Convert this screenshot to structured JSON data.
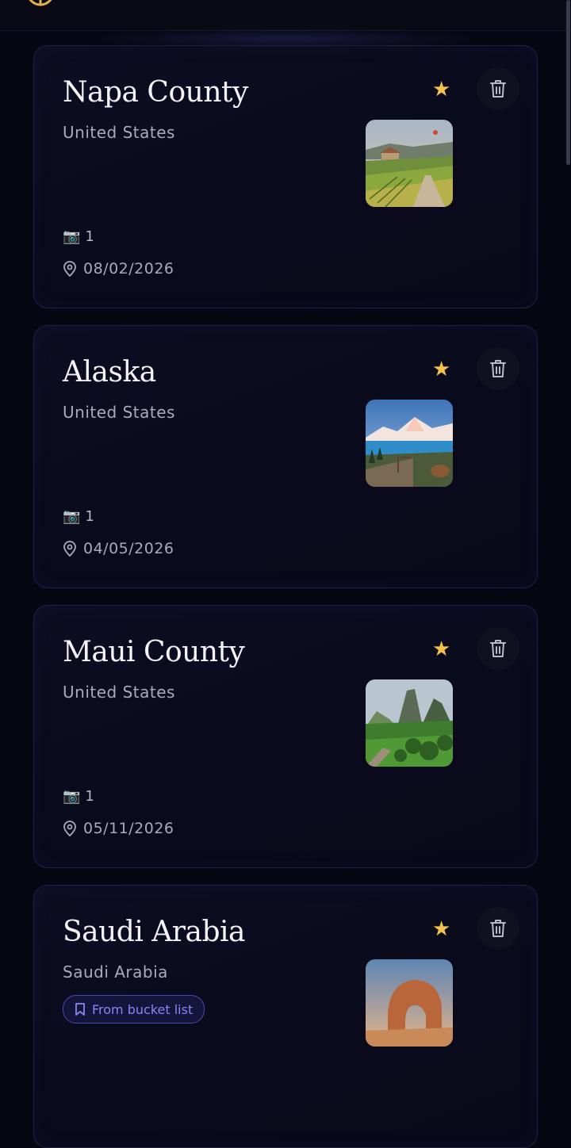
{
  "colors": {
    "background": "#070714",
    "card_border": "#1f2140",
    "star": "#f2c14e",
    "badge_accent": "#8b85f5",
    "logo": "#e0b24a"
  },
  "header": {
    "logo_icon": "globe-logo-icon"
  },
  "trips": [
    {
      "title": "Napa County",
      "country": "United States",
      "favorite": true,
      "photo_count": "1",
      "date": "08/02/2026",
      "thumbnail": "vineyard-photo"
    },
    {
      "title": "Alaska",
      "country": "United States",
      "favorite": true,
      "photo_count": "1",
      "date": "04/05/2026",
      "thumbnail": "mountain-lake-photo"
    },
    {
      "title": "Maui County",
      "country": "United States",
      "favorite": true,
      "photo_count": "1",
      "date": "05/11/2026",
      "thumbnail": "green-valley-photo"
    },
    {
      "title": "Saudi Arabia",
      "country": "Saudi Arabia",
      "favorite": true,
      "badge": "From bucket list",
      "thumbnail": "rock-arch-photo"
    }
  ],
  "icons": {
    "star": "★",
    "camera": "📷",
    "trash": "trash-icon",
    "location": "map-pin-icon",
    "bookmark": "bookmark-icon"
  }
}
